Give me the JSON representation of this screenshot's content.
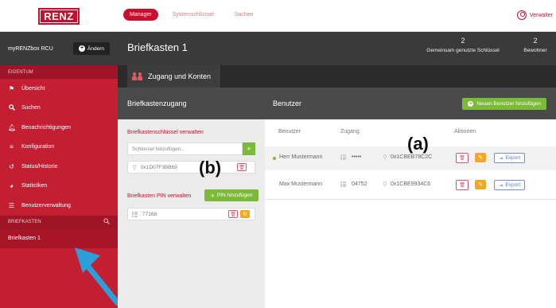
{
  "topbar": {
    "logo": "RENZ",
    "nav": [
      {
        "label": "Manager"
      },
      {
        "label": "Systemschlüssel"
      },
      {
        "label": "Suchen"
      }
    ],
    "user_label": "Verwalter"
  },
  "sidebar": {
    "box_name": "myRENZbox RCU",
    "change_label": "Ändern",
    "section_eigentum": "EIGENTUM",
    "items": [
      {
        "label": "Übersicht",
        "icon": "flag-icon"
      },
      {
        "label": "Suchen",
        "icon": "search-icon"
      },
      {
        "label": "Benachrichtigungen",
        "icon": "bell-icon"
      },
      {
        "label": "Konfiguration",
        "icon": "sliders-icon"
      },
      {
        "label": "Status/Historie",
        "icon": "history-icon"
      },
      {
        "label": "Statistiken",
        "icon": "pie-chart-icon"
      },
      {
        "label": "Benutzerverwaltung",
        "icon": "list-icon"
      }
    ],
    "section_briefkasten": "BRIEFKASTEN",
    "briefkasten_items": [
      {
        "label": "Briefkasten 1"
      }
    ]
  },
  "header": {
    "title": "Briefkasten 1",
    "stats": [
      {
        "num": "2",
        "label": "Gemeinsam genutzte Schlüssel"
      },
      {
        "num": "2",
        "label": "Bewohner"
      }
    ],
    "tab": "Zugang und Konten"
  },
  "zugang": {
    "title": "Briefkastenzugang",
    "keys_label": "Briefkastenschlüssel verwalten",
    "key_placeholder": "Schlüssel hinzufügen...",
    "key_value": "0x1D07F3BB69",
    "pin_label": "Briefkasten PIN verwalten",
    "pin_add": "PIN hinzufügen",
    "pin_value": "77168"
  },
  "benutzer": {
    "title": "Benutzer",
    "new_button": "Neuen Benutzer hinzufügen",
    "columns": [
      "Benutzer",
      "Zugang",
      "Aktionen"
    ],
    "rows": [
      {
        "name": "Herr Mustermann",
        "pin": "•••••",
        "key": "0x1CBEB78C2C",
        "export": "Export"
      },
      {
        "name": "Max Mustermann",
        "pin": "04752",
        "key": "0x1CBE9934C6",
        "export": "Export"
      }
    ]
  },
  "annotations": {
    "a": "(a)",
    "b": "(b)"
  },
  "colors": {
    "brand": "#c8102e",
    "dark": "#3a3a3a",
    "green": "#7cbb3a",
    "orange": "#f5a623",
    "arrow": "#2a9fd8"
  }
}
